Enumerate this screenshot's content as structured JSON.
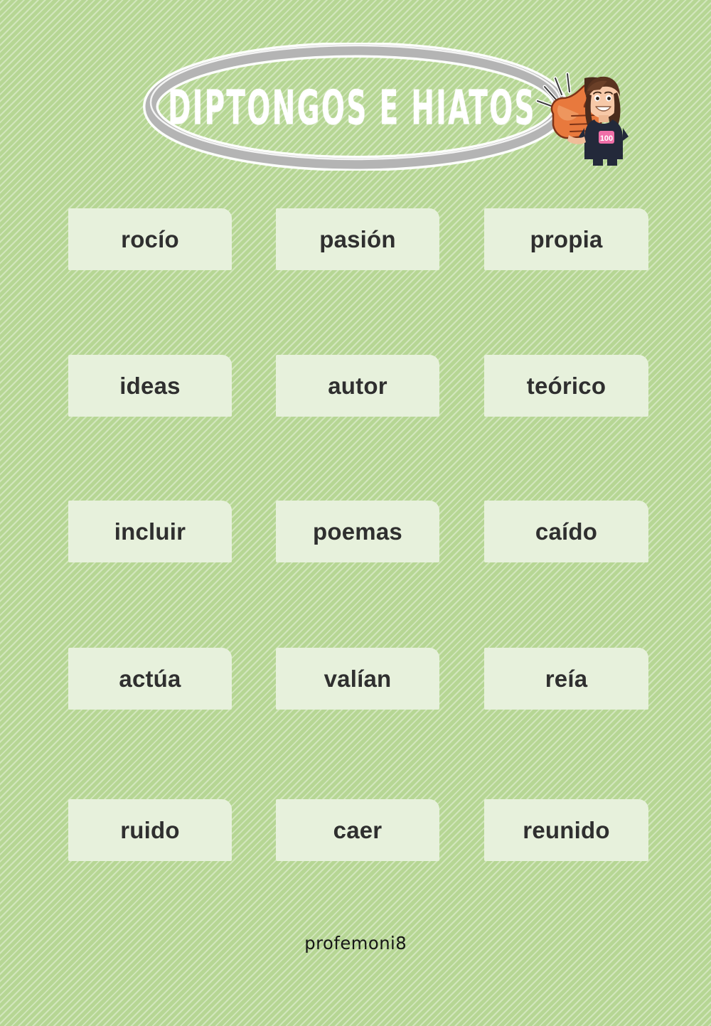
{
  "header": {
    "title": "DIPTONGOS E HIATOS",
    "ellipse_color": "#b4b4b4",
    "title_color": "#ffffff",
    "avatar_alt": "avatar-thumbs-up"
  },
  "theme": {
    "background_color": "#b6d694",
    "card_color": "#e7f1dc",
    "word_text_color": "#2f2f2f",
    "footer_text_color": "#161616"
  },
  "grid": {
    "columns": 3,
    "rows": 5,
    "cards": [
      {
        "word": "rocío",
        "row": 0,
        "col": 0
      },
      {
        "word": "pasión",
        "row": 0,
        "col": 1
      },
      {
        "word": "propia",
        "row": 0,
        "col": 2
      },
      {
        "word": "ideas",
        "row": 1,
        "col": 0
      },
      {
        "word": "autor",
        "row": 1,
        "col": 1
      },
      {
        "word": "teórico",
        "row": 1,
        "col": 2
      },
      {
        "word": "incluir",
        "row": 2,
        "col": 0
      },
      {
        "word": "poemas",
        "row": 2,
        "col": 1
      },
      {
        "word": "caído",
        "row": 2,
        "col": 2
      },
      {
        "word": "actúa",
        "row": 3,
        "col": 0
      },
      {
        "word": "valían",
        "row": 3,
        "col": 1
      },
      {
        "word": "reía",
        "row": 3,
        "col": 2
      },
      {
        "word": "ruido",
        "row": 4,
        "col": 0
      },
      {
        "word": "caer",
        "row": 4,
        "col": 1
      },
      {
        "word": "reunido",
        "row": 4,
        "col": 2
      }
    ]
  },
  "footer": {
    "credit": "profemoni8"
  }
}
